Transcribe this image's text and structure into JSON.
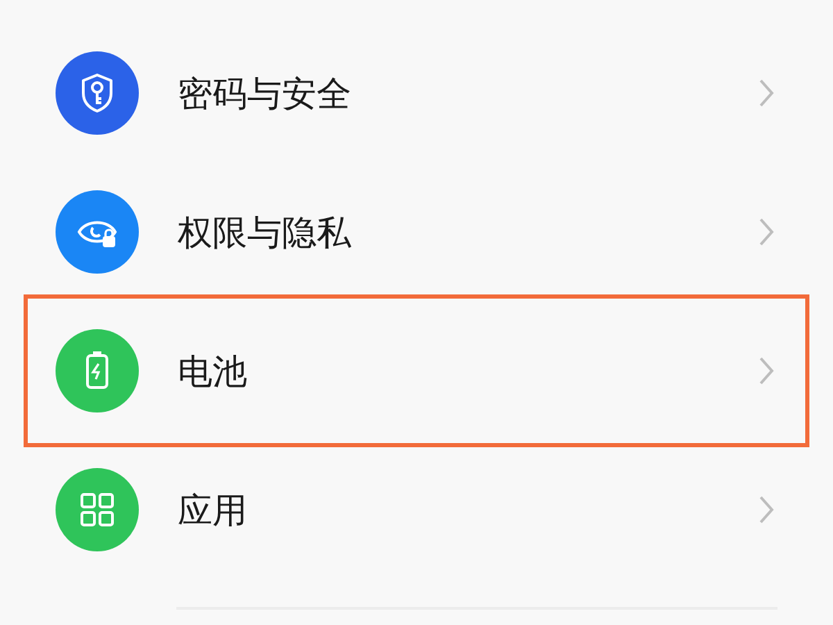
{
  "items": [
    {
      "label": "密码与安全",
      "kind": "security",
      "color": "#2b62e8",
      "highlighted": false
    },
    {
      "label": "权限与隐私",
      "kind": "privacy",
      "color": "#1a86f5",
      "highlighted": false
    },
    {
      "label": "电池",
      "kind": "battery",
      "color": "#2fc45a",
      "highlighted": true
    },
    {
      "label": "应用",
      "kind": "apps",
      "color": "#2fc45a",
      "highlighted": false
    }
  ]
}
